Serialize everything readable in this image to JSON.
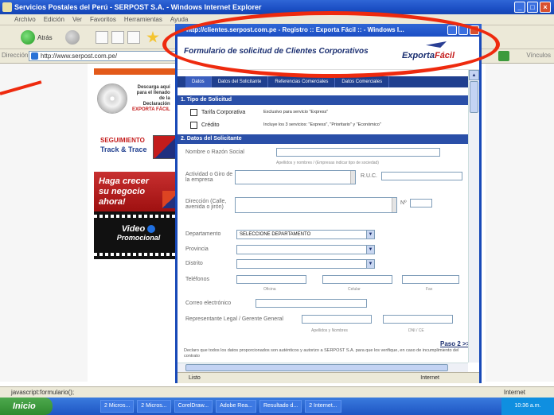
{
  "main_window": {
    "title": "Servicios Postales del Perú - SERPOST S.A. - Windows Internet Explorer",
    "menu": [
      "Archivo",
      "Edición",
      "Ver",
      "Favoritos",
      "Herramientas",
      "Ayuda"
    ],
    "back_label": "Atrás",
    "address_label": "Dirección",
    "address_value": "http://www.serpost.com.pe/",
    "links_label": "Vínculos",
    "status_text": "javascript:formulario();",
    "zone_label": "Internet"
  },
  "sidebar": {
    "docs_text": [
      "Descarga aquí",
      "para el llenado",
      "de la",
      "Declaración"
    ],
    "docs_brand": "EXPORTA FÁCIL",
    "track_line1": "SEGUIMIENTO",
    "track_line2": "Track & Trace",
    "crecer_text": [
      "Haga crecer",
      "su negocio",
      "ahora!"
    ],
    "video_line1": "Video",
    "video_line2": "Promocional"
  },
  "popup": {
    "title": "http://clientes.serpost.com.pe - Registro :: Exporta Fácil :: - Windows I...",
    "header_title": "Formulario de solicitud de Clientes Corporativos",
    "logo_main": "Exporta",
    "logo_accent": "Fácil",
    "tabs": [
      "Datos",
      "Datos del Solicitante",
      "Referencias Comerciales",
      "Datos Comerciales"
    ],
    "section1": "1. Tipo de Solicitud",
    "option1_label": "Tarifa Corporativa",
    "option1_desc": "Exclusivo para servicio \"Express\"",
    "option2_label": "Crédito",
    "option2_desc": "Incluye los 3 servicios: \"Express\", \"Prioritario\" y \"Económico\"",
    "section2": "2. Datos del Solicitante",
    "nombre_label": "Nombre o Razón Social",
    "nombre_hint": "Apellidos y nombres / (Empresas indicar tipo de sociedad)",
    "actividad_label": "Actividad o Giro de la empresa",
    "ruc_label": "R.U.C.",
    "direccion_label": "Dirección (Calle, avenida o jirón)",
    "num_label": "Nº",
    "departamento_label": "Departamento",
    "departamento_value": "SELECCIONE DEPARTAMENTO",
    "provincia_label": "Provincia",
    "distrito_label": "Distrito",
    "telefono_label": "Teléfonos",
    "tel_oficina": "Oficina",
    "tel_celular": "Celular",
    "tel_fax": "Fax",
    "correo_label": "Correo electrónico",
    "representante_label": "Representante Legal / Gerente General",
    "rep_hint1": "Apellidos y Nombres",
    "rep_hint2": "DNI / CE",
    "paso_link": "Paso 2 >>",
    "declaro": "Declaro que todos los datos proporcionados son auténticos y autorizo a SERPOST S.A. para que los verifique, en caso de incumplimiento del contrato",
    "status_text": "Listo",
    "zone_label": "Internet"
  },
  "taskbar": {
    "start_label": "Inicio",
    "tasks": [
      "2 Micros...",
      "2 Micros...",
      "CorelDraw...",
      "Adobe Rea...",
      "Resultado d...",
      "2 Internet..."
    ],
    "clock": "10:36 a.m."
  }
}
